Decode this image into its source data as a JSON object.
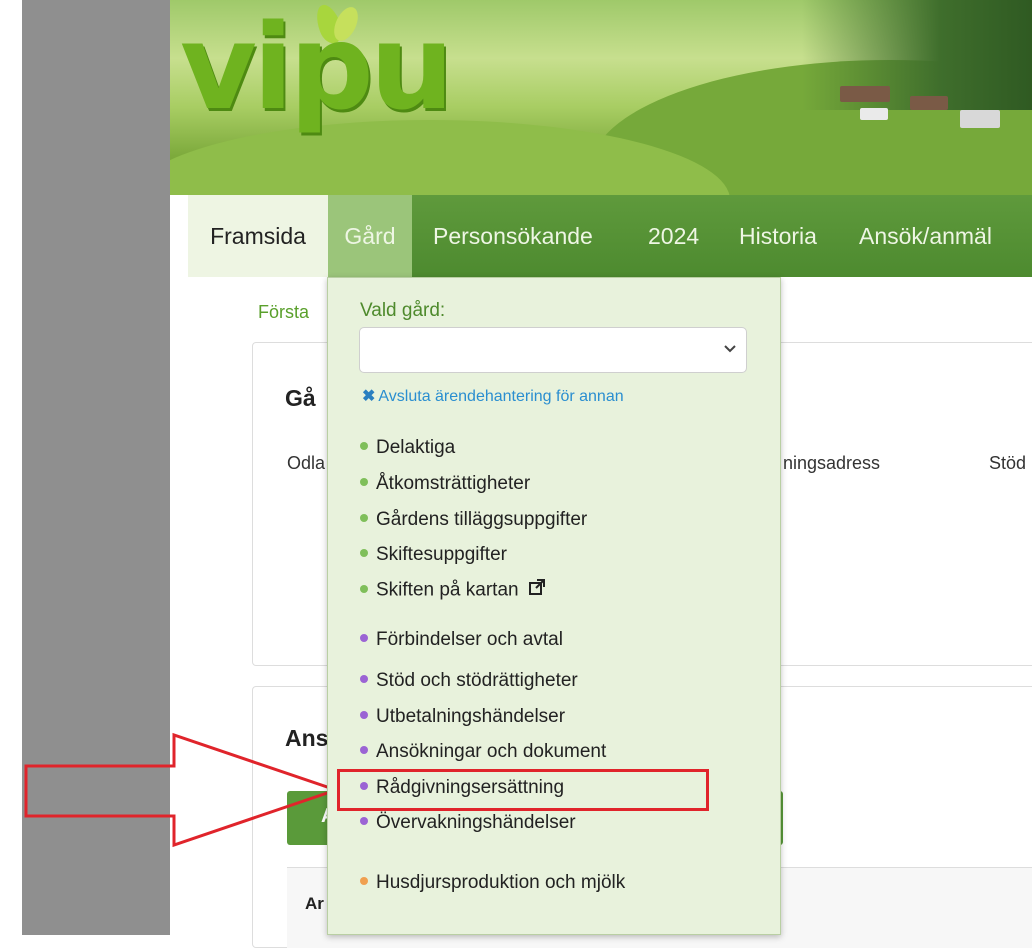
{
  "banner": {
    "logo_text": "vipu",
    "brand_color": "#6fb31f"
  },
  "nav": {
    "items": [
      {
        "label": "Framsida"
      },
      {
        "label": "Gård"
      },
      {
        "label": "Personsökande"
      },
      {
        "label": "2024"
      },
      {
        "label": "Historia"
      },
      {
        "label": "Ansök/anmäl"
      }
    ],
    "active": "Gård",
    "color": "#4d8a2f"
  },
  "breadcrumb": "Förstа",
  "farm_panel": {
    "title_fragment": "Gå",
    "col_odla": "Odla",
    "col_address_fragment": "ningsadress",
    "col_stod_fragment": "Stöd"
  },
  "applications_panel": {
    "title_fragment": "Ans",
    "button_fragment": "A",
    "table_header_fragment": "Ar"
  },
  "dropdown": {
    "chosen_farm_label": "Vald gård:",
    "select_value": "",
    "end_case_link": "Avsluta ärendehantering för annan",
    "group_basic": [
      {
        "label": "Delaktiga"
      },
      {
        "label": "Åtkomsträttigheter"
      },
      {
        "label": "Gårdens tilläggsuppgifter"
      },
      {
        "label": "Skiftesuppgifter"
      },
      {
        "label": "Skiften på kartan"
      }
    ],
    "group_support": [
      {
        "label": "Förbindelser och avtal"
      },
      {
        "label": "Stöd och stödrättigheter"
      },
      {
        "label": "Utbetalningshändelser"
      },
      {
        "label": "Ansökningar och dokument"
      },
      {
        "label": "Rådgivningsersättning"
      },
      {
        "label": "Övervakningshändelser"
      }
    ],
    "group_animals": [
      {
        "label": "Husdjursproduktion och mjölk"
      }
    ],
    "highlighted_item": "Rådgivningsersättning",
    "highlight_color": "#e0242b"
  }
}
